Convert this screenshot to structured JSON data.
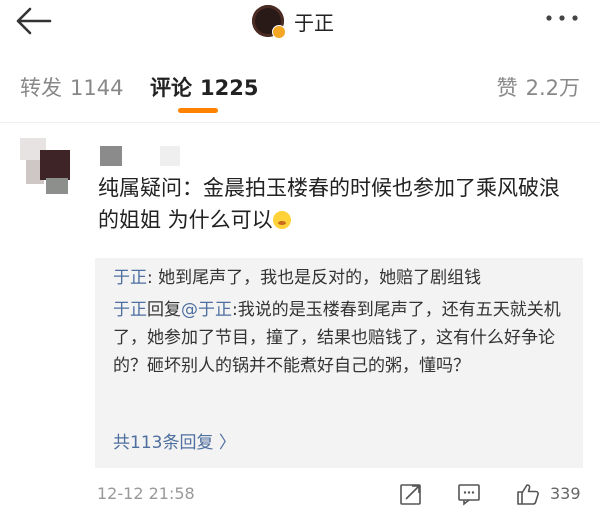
{
  "header": {
    "title": "于正"
  },
  "tabs": [
    {
      "label": "转发",
      "count": "1144"
    },
    {
      "label": "评论",
      "count": "1225"
    },
    {
      "label": "赞",
      "count": "2.2万"
    }
  ],
  "comment": {
    "text": "纯属疑问：金晨拍玉楼春的时候也参加了乘风破浪的姐姐 为什么可以",
    "time": "12-12 21:58",
    "like_count": "339",
    "emoji": "thinking-face-icon"
  },
  "replies": [
    {
      "user": "于正",
      "sep": ": ",
      "text": "她到尾声了，我也是反对的，她赔了剧组钱"
    },
    {
      "user": "于正",
      "action": "回复",
      "mention": "@于正",
      "text": ":我说的是玉楼春到尾声了，还有五天就关机了，她参加了节目，撞了，结果也赔钱了，这有什么好争论的？砸坏别人的锅并不能煮好自己的粥，懂吗？"
    }
  ],
  "more_replies": "共113条回复 〉",
  "colors": {
    "accent": "#ff8200",
    "link": "#4e6f9f",
    "reply_bg": "#f3f3f3"
  }
}
